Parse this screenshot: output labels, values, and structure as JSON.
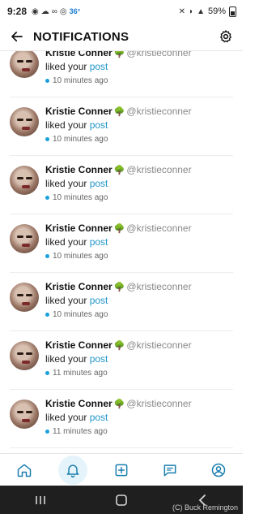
{
  "status_bar": {
    "time": "9:28",
    "temperature": "36°",
    "battery": "59%"
  },
  "header": {
    "title": "NOTIFICATIONS"
  },
  "notifications": [
    {
      "name": "Kristie Conner",
      "handle": "@kristieconner",
      "action": "liked your",
      "link": "post",
      "time": "10 minutes ago"
    },
    {
      "name": "Kristie Conner",
      "handle": "@kristieconner",
      "action": "liked your",
      "link": "post",
      "time": "10 minutes ago"
    },
    {
      "name": "Kristie Conner",
      "handle": "@kristieconner",
      "action": "liked your",
      "link": "post",
      "time": "10 minutes ago"
    },
    {
      "name": "Kristie Conner",
      "handle": "@kristieconner",
      "action": "liked your",
      "link": "post",
      "time": "10 minutes ago"
    },
    {
      "name": "Kristie Conner",
      "handle": "@kristieconner",
      "action": "liked your",
      "link": "post",
      "time": "10 minutes ago"
    },
    {
      "name": "Kristie Conner",
      "handle": "@kristieconner",
      "action": "liked your",
      "link": "post",
      "time": "11 minutes ago"
    },
    {
      "name": "Kristie Conner",
      "handle": "@kristieconner",
      "action": "liked your",
      "link": "post",
      "time": "11 minutes ago"
    }
  ],
  "bottom_nav": {
    "items": [
      "home-icon",
      "bell-icon",
      "plus-square-icon",
      "message-icon",
      "profile-icon"
    ],
    "active": "bell-icon"
  },
  "watermark": "(C) Buck Remington",
  "colors": {
    "accent": "#2196c9",
    "unread_dot": "#1aa0dd",
    "active_nav_bg": "#e5f4fb"
  }
}
